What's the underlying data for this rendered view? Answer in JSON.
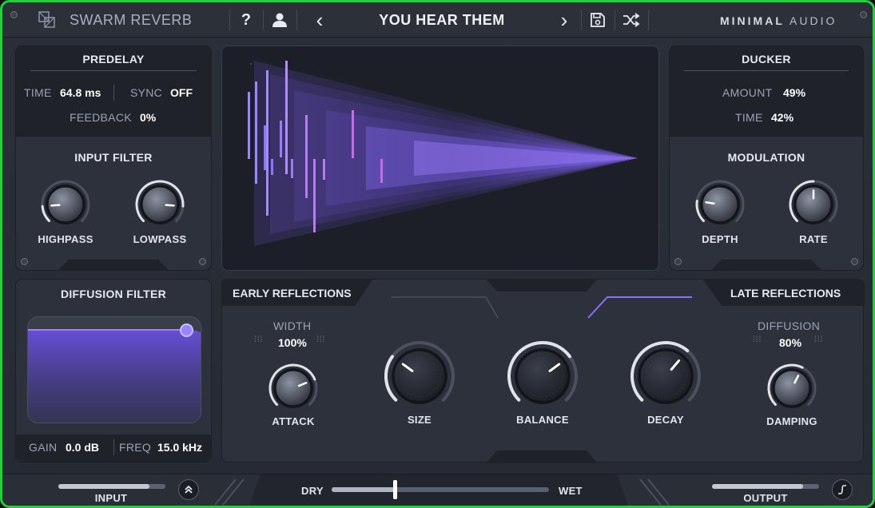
{
  "header": {
    "plugin_name": "SWARM REVERB",
    "help_label": "?",
    "prev_label": "‹",
    "preset_name": "YOU HEAR THEM",
    "next_label": "›",
    "brand_bold": "MINIMAL",
    "brand_light": "AUDIO",
    "icons": [
      "logo-icon",
      "help-icon",
      "user-icon",
      "chevron-left-icon",
      "chevron-right-icon",
      "save-icon",
      "shuffle-icon"
    ]
  },
  "predelay": {
    "title": "PREDELAY",
    "time_label": "TIME",
    "time_value": "64.8 ms",
    "sync_label": "SYNC",
    "sync_value": "OFF",
    "feedback_label": "FEEDBACK",
    "feedback_value": "0%"
  },
  "input_filter": {
    "title": "INPUT FILTER",
    "highpass_label": "HIGHPASS",
    "lowpass_label": "LOWPASS",
    "highpass_level": 0.15,
    "lowpass_level": 0.85
  },
  "ducker": {
    "title": "DUCKER",
    "amount_label": "AMOUNT",
    "amount_value": "49%",
    "time_label": "TIME",
    "time_value": "42%"
  },
  "modulation": {
    "title": "MODULATION",
    "depth_label": "DEPTH",
    "rate_label": "RATE",
    "depth_level": 0.2,
    "rate_level": 0.5
  },
  "diffusion_filter": {
    "title": "DIFFUSION FILTER",
    "gain_label": "GAIN",
    "gain_value": "0.0 dB",
    "freq_label": "FREQ",
    "freq_value": "15.0 kHz"
  },
  "early_reflections": {
    "title": "EARLY REFLECTIONS",
    "width_label": "WIDTH",
    "width_value": "100%",
    "attack_label": "ATTACK",
    "attack_level": 0.75
  },
  "center_knobs": {
    "size_label": "SIZE",
    "balance_label": "BALANCE",
    "decay_label": "DECAY",
    "size_level": 0.3,
    "balance_level": 0.7,
    "decay_level": 0.65
  },
  "late_reflections": {
    "title": "LATE REFLECTIONS",
    "diffusion_label": "DIFFUSION",
    "diffusion_value": "80%",
    "damping_label": "DAMPING",
    "damping_level": 0.6
  },
  "footer": {
    "input_label": "INPUT",
    "output_label": "OUTPUT",
    "dry_label": "DRY",
    "wet_label": "WET",
    "drywet_level": 0.29,
    "input_level": 0.85,
    "output_level": 0.85
  },
  "colors": {
    "accent": "#8a6cff",
    "accent_pink": "#c86be8",
    "panel": "#2d313b",
    "panel_dark": "#1f2229",
    "highlight_border": "#1fd33a"
  }
}
